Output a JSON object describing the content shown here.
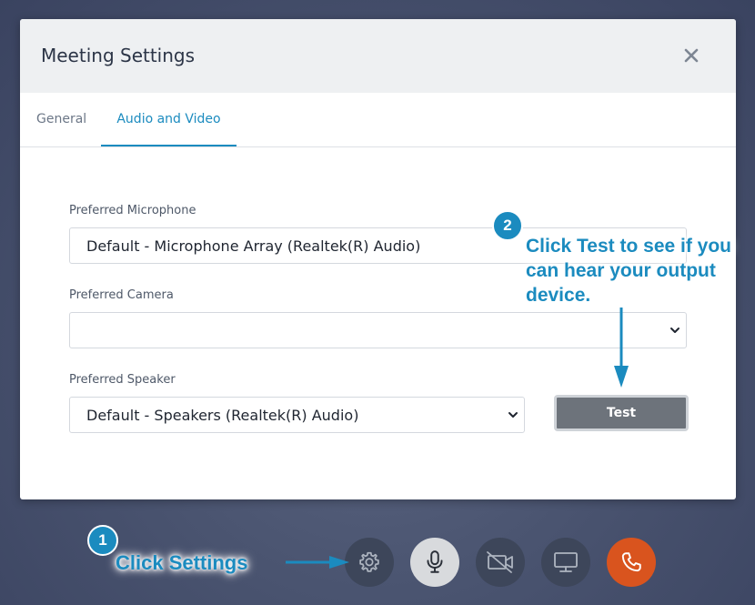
{
  "modal": {
    "title": "Meeting Settings",
    "close_icon": "close-icon"
  },
  "tabs": [
    {
      "label": "General",
      "active": false
    },
    {
      "label": "Audio and Video",
      "active": true
    }
  ],
  "fields": {
    "microphone": {
      "label": "Preferred Microphone",
      "value": "Default - Microphone Array (Realtek(R) Audio)"
    },
    "camera": {
      "label": "Preferred Camera",
      "value": ""
    },
    "speaker": {
      "label": "Preferred Speaker",
      "value": "Default - Speakers (Realtek(R) Audio)"
    }
  },
  "test_button": {
    "label": "Test"
  },
  "callouts": {
    "step1": {
      "number": "1",
      "text": "Click Settings"
    },
    "step2": {
      "number": "2",
      "text": "Click Test to see if you can hear your output device."
    }
  },
  "toolbar": {
    "buttons": [
      {
        "icon": "gear-icon"
      },
      {
        "icon": "microphone-icon"
      },
      {
        "icon": "camera-off-icon"
      },
      {
        "icon": "screen-share-icon"
      },
      {
        "icon": "phone-hangup-icon"
      }
    ]
  },
  "colors": {
    "accent": "#1b8bbf",
    "hangup": "#d9541e",
    "toolbar_dark": "#3d465a",
    "mic_active": "#d8dadd"
  }
}
